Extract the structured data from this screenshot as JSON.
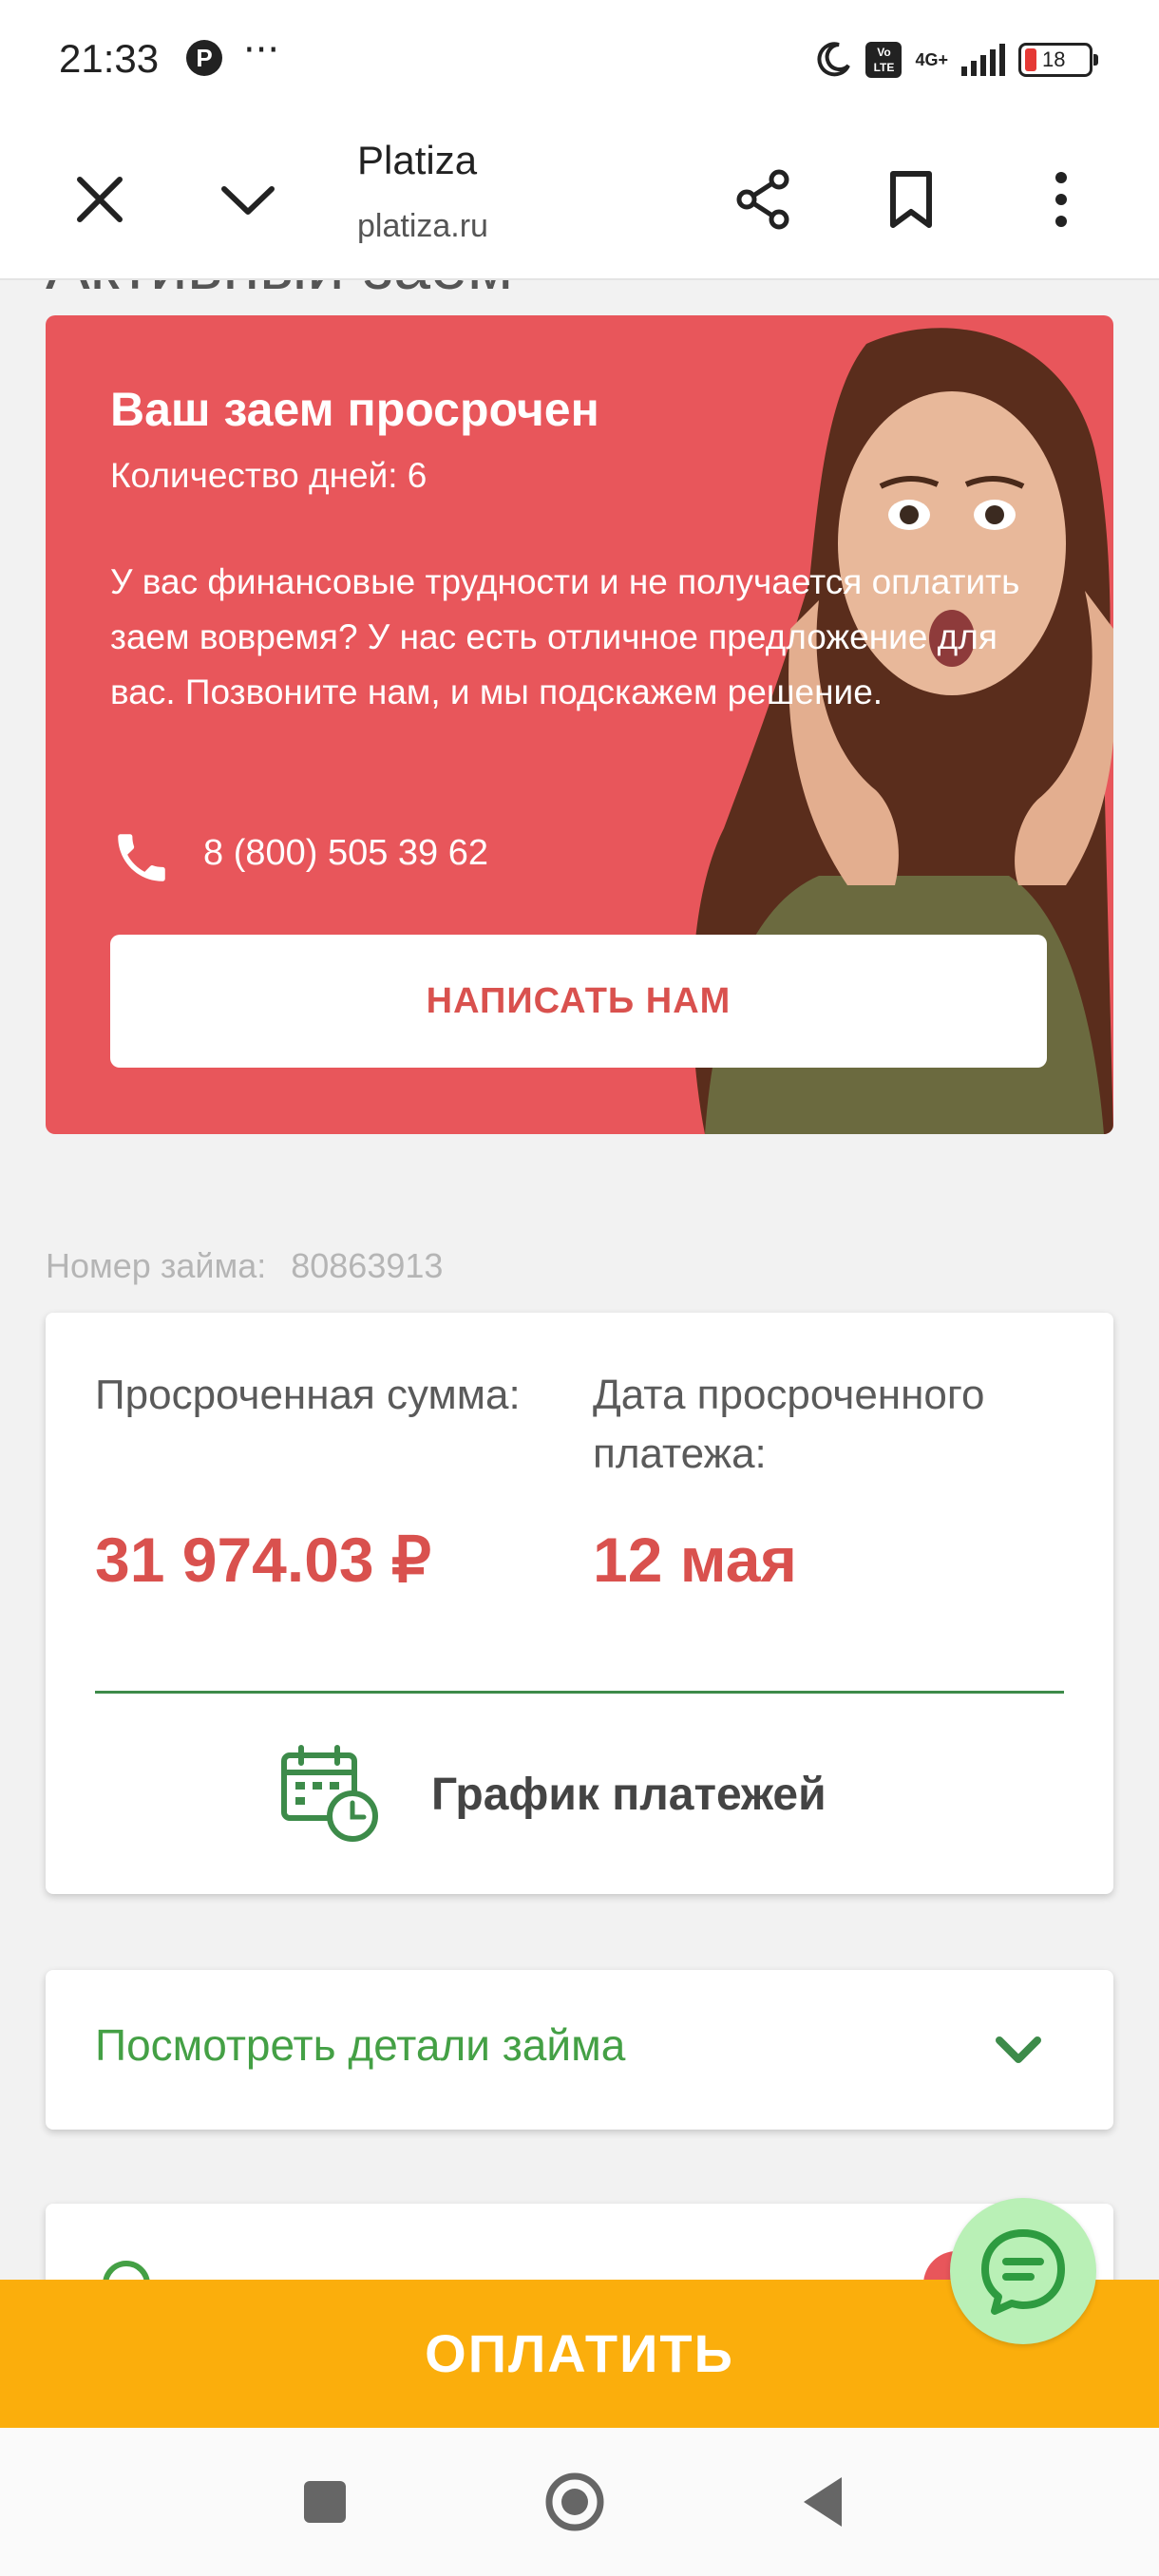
{
  "status_bar": {
    "time": "21:33",
    "pin_glyph": "P",
    "dots": "···",
    "volte_line1": "Vo",
    "volte_line2": "LTE",
    "network": "4G+",
    "battery": "18"
  },
  "browser": {
    "title": "Platiza",
    "url": "platiza.ru",
    "icons": [
      "close-icon",
      "chevron-down-icon",
      "share-icon",
      "bookmark-icon",
      "more-vert-icon"
    ]
  },
  "page": {
    "heading_peek": "Активный заем",
    "alert": {
      "title": "Ваш заем просрочен",
      "days": "Количество дней: 6",
      "text": "У вас финансовые трудности и не получается оплатить заем вовремя? У нас есть отличное предложение для вас. Позвоните нам, и мы подскажем решение.",
      "phone": "8 (800) 505 39 62",
      "button": "НАПИСАТЬ НАМ",
      "color": "#e8565b"
    },
    "loan_number_label": "Номер займа:",
    "loan_number": "80863913",
    "summary": {
      "overdue_amount_label": "Просроченная сумма:",
      "overdue_amount": "31 974.03 ₽",
      "overdue_date_label": "Дата просроченного платежа:",
      "overdue_date": "12 мая",
      "schedule_label": "График платежей"
    },
    "details_label": "Посмотреть детали займа",
    "pay_button": "ОПЛАТИТЬ",
    "accent_green": "#44a045",
    "accent_orange": "#fbae0c"
  },
  "nav": [
    "recents-square-icon",
    "home-circle-icon",
    "back-triangle-icon"
  ]
}
